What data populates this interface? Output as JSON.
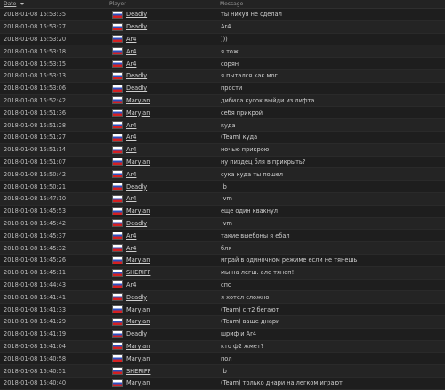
{
  "header": {
    "date": "Date",
    "player": "Player",
    "message": "Message"
  },
  "rows": [
    {
      "date": "2018-01-08 15:53:35",
      "player": "Deadly",
      "message": "ты нихуя не сделал"
    },
    {
      "date": "2018-01-08 15:53:27",
      "player": "Deadly",
      "message": "Ar4"
    },
    {
      "date": "2018-01-08 15:53:20",
      "player": "Ar4",
      "message": ")))"
    },
    {
      "date": "2018-01-08 15:53:18",
      "player": "Ar4",
      "message": "я тож"
    },
    {
      "date": "2018-01-08 15:53:15",
      "player": "Ar4",
      "message": "сорян"
    },
    {
      "date": "2018-01-08 15:53:13",
      "player": "Deadly",
      "message": "я пытался как мог"
    },
    {
      "date": "2018-01-08 15:53:06",
      "player": "Deadly",
      "message": "прости"
    },
    {
      "date": "2018-01-08 15:52:42",
      "player": "Maryjan",
      "message": "дибила кусок выйди из лифта"
    },
    {
      "date": "2018-01-08 15:51:36",
      "player": "Maryjan",
      "message": "себя прикрой"
    },
    {
      "date": "2018-01-08 15:51:28",
      "player": "Ar4",
      "message": "куда"
    },
    {
      "date": "2018-01-08 15:51:27",
      "player": "Ar4",
      "message": "(Team) куда"
    },
    {
      "date": "2018-01-08 15:51:14",
      "player": "Ar4",
      "message": "ночью прикрою"
    },
    {
      "date": "2018-01-08 15:51:07",
      "player": "Maryjan",
      "message": "ну пиздец бля в прикрыть?"
    },
    {
      "date": "2018-01-08 15:50:42",
      "player": "Ar4",
      "message": "сука куда ты пошел"
    },
    {
      "date": "2018-01-08 15:50:21",
      "player": "Deadly",
      "message": "!b"
    },
    {
      "date": "2018-01-08 15:47:10",
      "player": "Ar4",
      "message": "!vm"
    },
    {
      "date": "2018-01-08 15:45:53",
      "player": "Maryjan",
      "message": "еще один квакнул"
    },
    {
      "date": "2018-01-08 15:45:42",
      "player": "Deadly",
      "message": "!vm"
    },
    {
      "date": "2018-01-08 15:45:37",
      "player": "Ar4",
      "message": "такие выебоны я ебал"
    },
    {
      "date": "2018-01-08 15:45:32",
      "player": "Ar4",
      "message": "бля"
    },
    {
      "date": "2018-01-08 15:45:26",
      "player": "Maryjan",
      "message": "играй в одиночном режиме если не тянешь"
    },
    {
      "date": "2018-01-08 15:45:11",
      "player": "SHERIFF",
      "message": "мы на легш. але тянеп!"
    },
    {
      "date": "2018-01-08 15:44:43",
      "player": "Ar4",
      "message": "спс"
    },
    {
      "date": "2018-01-08 15:41:41",
      "player": "Deadly",
      "message": "я хотел сложно"
    },
    {
      "date": "2018-01-08 15:41:33",
      "player": "Maryjan",
      "message": "(Team) с т2 бегают"
    },
    {
      "date": "2018-01-08 15:41:29",
      "player": "Maryjan",
      "message": "(Team) ваще днари"
    },
    {
      "date": "2018-01-08 15:41:19",
      "player": "Deadly",
      "message": "шриф и Ar4"
    },
    {
      "date": "2018-01-08 15:41:04",
      "player": "Maryjan",
      "message": "кто ф2 жмет?"
    },
    {
      "date": "2018-01-08 15:40:58",
      "player": "Maryjan",
      "message": "пол"
    },
    {
      "date": "2018-01-08 15:40:51",
      "player": "SHERIFF",
      "message": "!b"
    },
    {
      "date": "2018-01-08 15:40:40",
      "player": "Maryjan",
      "message": "(Team) только днари на легком играют"
    }
  ]
}
